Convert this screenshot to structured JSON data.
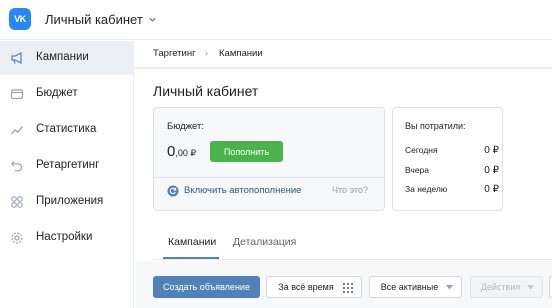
{
  "header": {
    "logo_text": "VK",
    "cabinet_label": "Личный кабинет"
  },
  "sidebar": {
    "items": [
      {
        "label": "Кампании",
        "icon": "megaphone-icon",
        "active": true
      },
      {
        "label": "Бюджет",
        "icon": "wallet-icon",
        "active": false
      },
      {
        "label": "Статистика",
        "icon": "stats-trend-icon",
        "active": false
      },
      {
        "label": "Ретаргетинг",
        "icon": "retarget-arrow-icon",
        "active": false
      },
      {
        "label": "Приложения",
        "icon": "apps-grid-icon",
        "active": false
      },
      {
        "label": "Настройки",
        "icon": "gear-icon",
        "active": false
      }
    ]
  },
  "breadcrumb": {
    "items": [
      "Таргетинг",
      "Кампании"
    ],
    "separator": "›"
  },
  "page": {
    "title": "Личный кабинет"
  },
  "budget": {
    "label": "Бюджет:",
    "amount_int": "0",
    "amount_dec": ",00 ₽",
    "topup_label": "Пополнить",
    "autopay_label": "Включить автопополнение",
    "what_label": "Что это?"
  },
  "spent": {
    "title": "Вы потратили:",
    "rows": [
      {
        "label": "Сегодня",
        "value": "0 ₽"
      },
      {
        "label": "Вчера",
        "value": "0 ₽"
      },
      {
        "label": "За неделю",
        "value": "0 ₽"
      }
    ]
  },
  "tabs": [
    {
      "label": "Кампании",
      "active": true
    },
    {
      "label": "Детализация",
      "active": false
    }
  ],
  "toolbar": {
    "create_label": "Создать объявление",
    "period_label": "За всё время",
    "status_label": "Все активные",
    "actions_label": "Действия"
  },
  "colors": {
    "accent": "#5181b8",
    "logo": "#2787f5",
    "topup": "#4bb34b",
    "link": "#2a5885"
  }
}
